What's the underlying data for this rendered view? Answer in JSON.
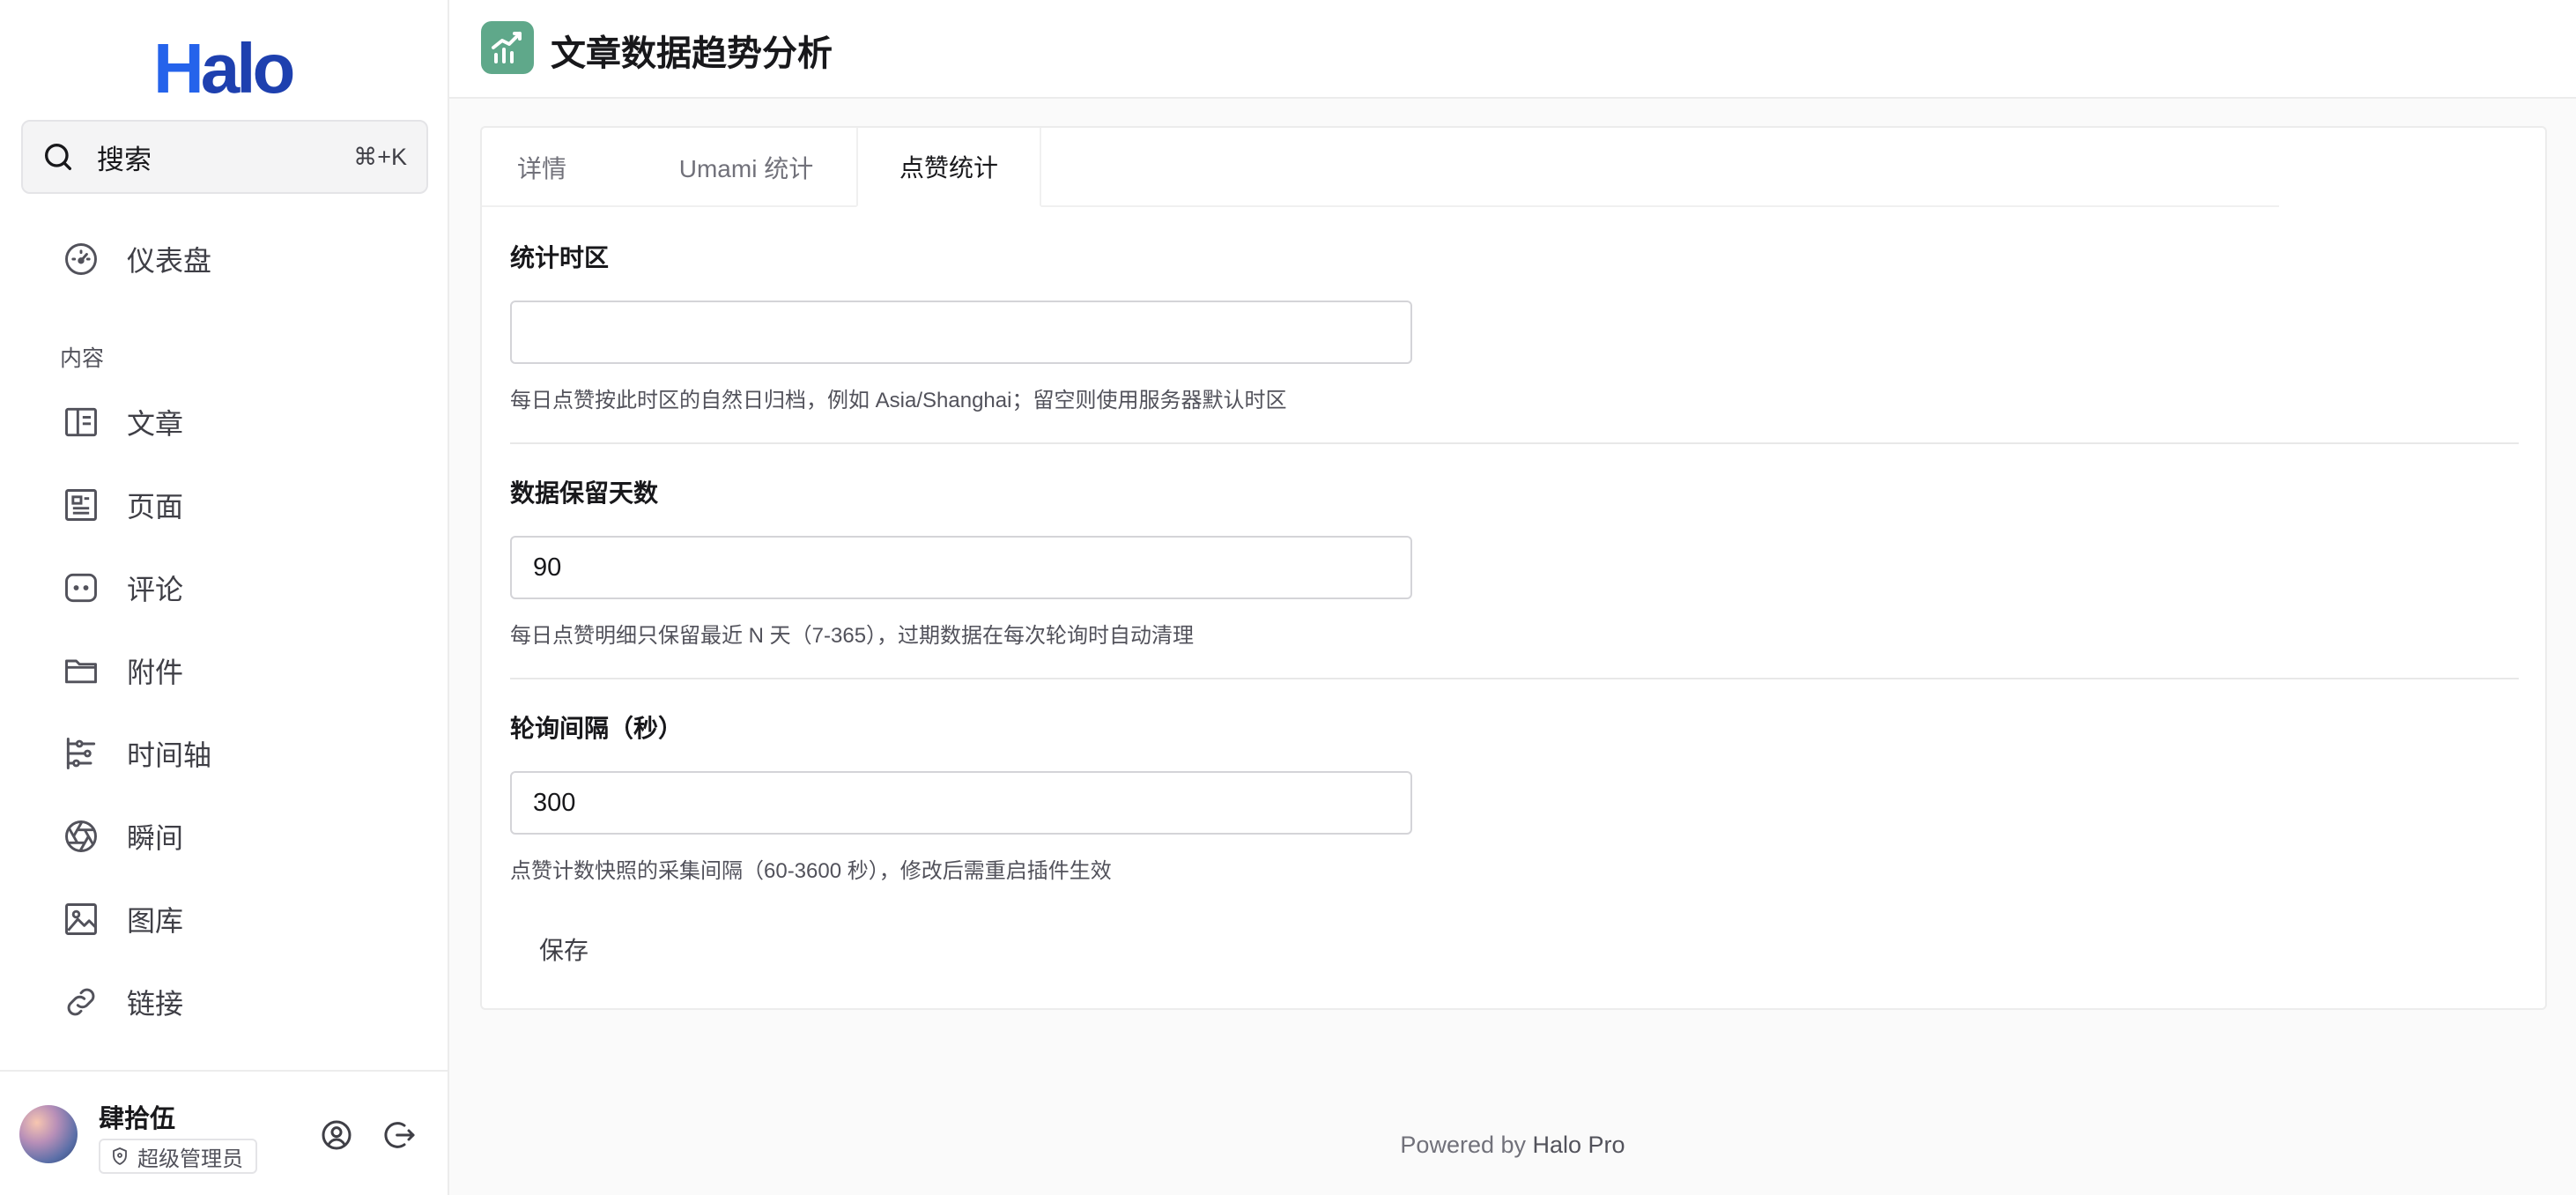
{
  "sidebar": {
    "logo": {
      "part1": "H",
      "part2": "alo"
    },
    "search": {
      "label": "搜索",
      "shortcut": "⌘+K"
    },
    "dashboard": {
      "label": "仪表盘",
      "icon": "dashboard-icon"
    },
    "group_label": "内容",
    "items": [
      {
        "label": "文章",
        "icon": "book-open-icon"
      },
      {
        "label": "页面",
        "icon": "page-icon"
      },
      {
        "label": "评论",
        "icon": "comment-icon"
      },
      {
        "label": "附件",
        "icon": "folder-icon"
      },
      {
        "label": "时间轴",
        "icon": "timeline-icon"
      },
      {
        "label": "瞬间",
        "icon": "aperture-icon"
      },
      {
        "label": "图库",
        "icon": "image-icon"
      },
      {
        "label": "链接",
        "icon": "link-icon"
      }
    ],
    "user": {
      "name": "肆拾伍",
      "role": "超级管理员"
    }
  },
  "header": {
    "title": "文章数据趋势分析",
    "icon": "chart-trend-icon"
  },
  "tabs": [
    {
      "label": "详情",
      "active": false
    },
    {
      "label": "Umami 统计",
      "active": false
    },
    {
      "label": "点赞统计",
      "active": true
    }
  ],
  "form": {
    "timezone": {
      "label": "统计时区",
      "value": "",
      "help": "每日点赞按此时区的自然日归档，例如 Asia/Shanghai；留空则使用服务器默认时区"
    },
    "retention": {
      "label": "数据保留天数",
      "value": "90",
      "help": "每日点赞明细只保留最近 N 天（7-365），过期数据在每次轮询时自动清理"
    },
    "interval": {
      "label": "轮询间隔（秒）",
      "value": "300",
      "help": "点赞计数快照的采集间隔（60-3600 秒），修改后需重启插件生效"
    },
    "save_label": "保存"
  },
  "footer": {
    "prefix": "Powered by ",
    "brand": "Halo Pro"
  },
  "colors": {
    "logo": "#2563eb",
    "app_icon_bg": "#5fa88a",
    "border": "#ececec"
  }
}
